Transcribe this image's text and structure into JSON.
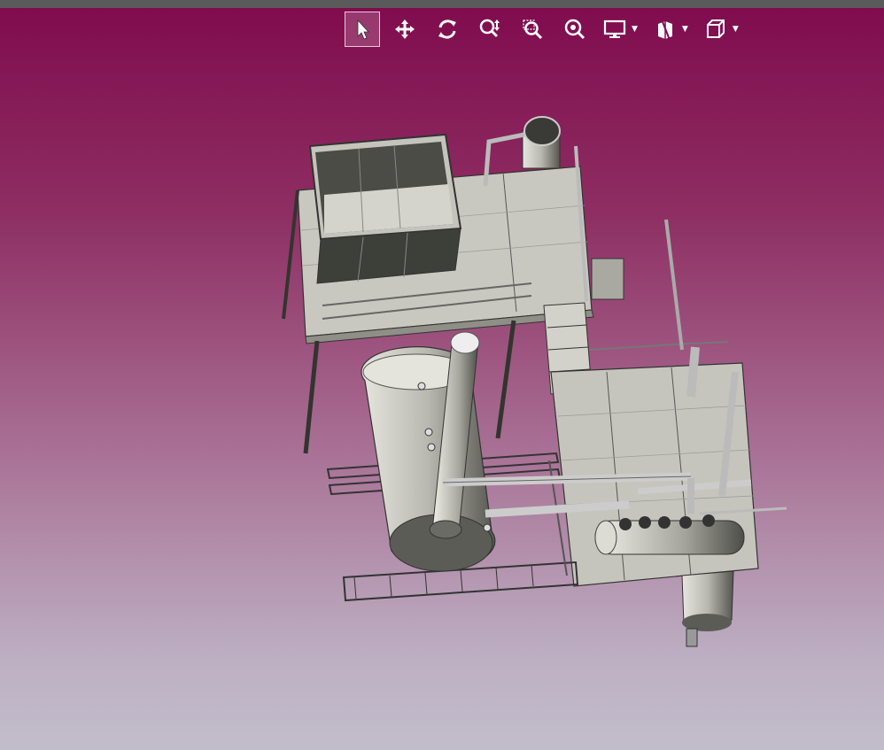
{
  "toolbar": {
    "tools": [
      {
        "name": "select-icon",
        "active": true
      },
      {
        "name": "pan-icon",
        "active": false
      },
      {
        "name": "rotate-icon",
        "active": false
      },
      {
        "name": "zoom-icon",
        "active": false
      },
      {
        "name": "zoom-window-icon",
        "active": false
      },
      {
        "name": "zoom-fit-icon",
        "active": false
      }
    ],
    "dropdowns": [
      "display-mode-icon",
      "section-view-icon",
      "view-cube-icon"
    ]
  },
  "colors": {
    "bg_top": "#800c4e",
    "bg_bottom": "#c2bdcb",
    "model_fill": "#c9c8c0",
    "model_dark": "#3a3c36",
    "toolbar_icon": "#ffffff"
  }
}
